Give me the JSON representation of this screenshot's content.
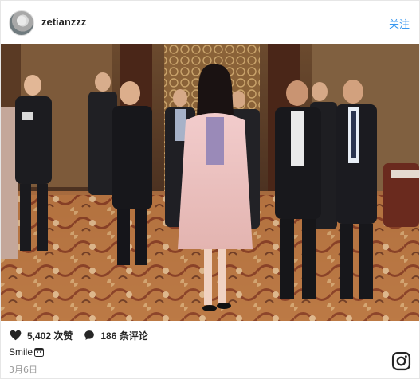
{
  "header": {
    "username": "zetianzzz",
    "follow_label": "关注"
  },
  "photo": {
    "subject": "group-photo"
  },
  "stats": {
    "likes_text": "5,402 次赞",
    "comments_text": "186 条评论"
  },
  "caption": {
    "text": "Smile"
  },
  "date_text": "3月6日",
  "colors": {
    "follow_link": "#3897f0",
    "text": "#262626",
    "muted": "#999999",
    "border": "#e6e6e6"
  },
  "icons": [
    "heart-icon",
    "comment-icon",
    "emoji-icon",
    "instagram-icon"
  ]
}
